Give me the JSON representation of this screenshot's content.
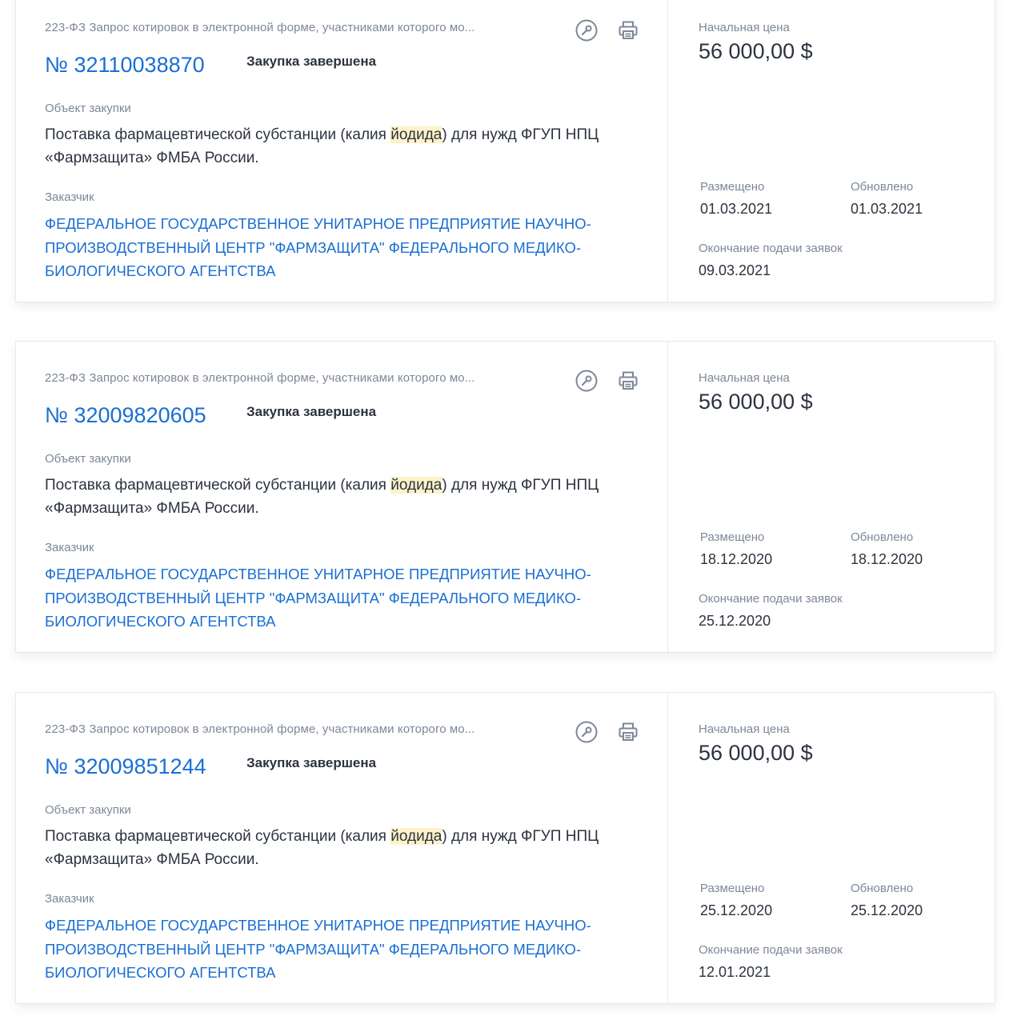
{
  "labels": {
    "object": "Объект закупки",
    "customer": "Заказчик",
    "initial_price": "Начальная цена",
    "posted": "Размещено",
    "updated": "Обновлено",
    "deadline": "Окончание подачи заявок",
    "number_prefix": "№ "
  },
  "cards": [
    {
      "law": "223-ФЗ Запрос котировок в электронной форме, участниками которого мо...",
      "number": "32110038870",
      "status": "Закупка завершена",
      "object_before": "Поставка фармацевтической субстанции (калия ",
      "object_highlight": "йодида",
      "object_after": ") для нужд ФГУП НПЦ «Фармзащита» ФМБА России.",
      "customer": "ФЕДЕРАЛЬНОЕ ГОСУДАРСТВЕННОЕ УНИТАРНОЕ ПРЕДПРИЯТИЕ НАУЧНО-ПРОИЗВОДСТВЕННЫЙ ЦЕНТР \"ФАРМЗАЩИТА\" ФЕДЕРАЛЬНОГО МЕДИКО-БИОЛОГИЧЕСКОГО АГЕНТСТВА",
      "price": "56 000,00 $",
      "posted": "01.03.2021",
      "updated": "01.03.2021",
      "deadline": "09.03.2021"
    },
    {
      "law": "223-ФЗ Запрос котировок в электронной форме, участниками которого мо...",
      "number": "32009820605",
      "status": "Закупка завершена",
      "object_before": "Поставка фармацевтической субстанции (калия ",
      "object_highlight": "йодида",
      "object_after": ") для нужд ФГУП НПЦ «Фармзащита» ФМБА России.",
      "customer": "ФЕДЕРАЛЬНОЕ ГОСУДАРСТВЕННОЕ УНИТАРНОЕ ПРЕДПРИЯТИЕ НАУЧНО-ПРОИЗВОДСТВЕННЫЙ ЦЕНТР \"ФАРМЗАЩИТА\" ФЕДЕРАЛЬНОГО МЕДИКО-БИОЛОГИЧЕСКОГО АГЕНТСТВА",
      "price": "56 000,00 $",
      "posted": "18.12.2020",
      "updated": "18.12.2020",
      "deadline": "25.12.2020"
    },
    {
      "law": "223-ФЗ Запрос котировок в электронной форме, участниками которого мо...",
      "number": "32009851244",
      "status": "Закупка завершена",
      "object_before": "Поставка фармацевтической субстанции (калия ",
      "object_highlight": "йодида",
      "object_after": ") для нужд ФГУП НПЦ «Фармзащита» ФМБА России.",
      "customer": "ФЕДЕРАЛЬНОЕ ГОСУДАРСТВЕННОЕ УНИТАРНОЕ ПРЕДПРИЯТИЕ НАУЧНО-ПРОИЗВОДСТВЕННЫЙ ЦЕНТР \"ФАРМЗАЩИТА\" ФЕДЕРАЛЬНОГО МЕДИКО-БИОЛОГИЧЕСКОГО АГЕНТСТВА",
      "price": "56 000,00 $",
      "posted": "25.12.2020",
      "updated": "25.12.2020",
      "deadline": "12.01.2021"
    }
  ],
  "icons": {
    "key": "key-icon",
    "print": "printer-icon"
  },
  "colors": {
    "link": "#1a6fd3",
    "highlight": "#fdf2c9",
    "muted": "#7d8798",
    "text": "#2c3340"
  }
}
